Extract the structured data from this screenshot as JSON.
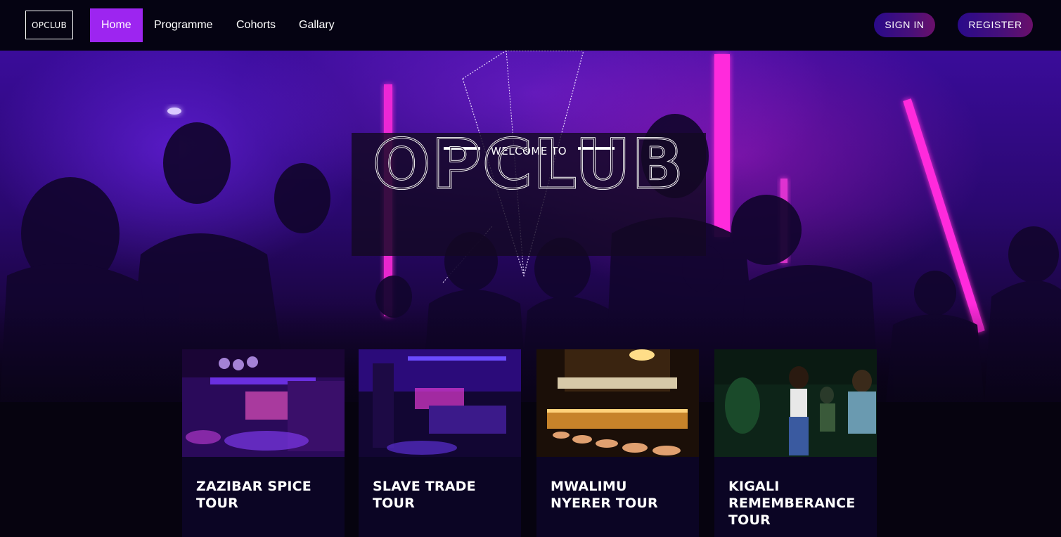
{
  "nav": {
    "logo": "OPCLUB",
    "links": [
      "Home",
      "Programme",
      "Cohorts",
      "Gallary"
    ],
    "active_link": "Home",
    "sign_in": "SIGN IN",
    "register": "REGISTER"
  },
  "hero": {
    "welcome": "WELCOME TO",
    "title": "OPCLUB"
  },
  "cards": [
    {
      "title": "ZAZIBAR SPICE TOUR"
    },
    {
      "title": "SLAVE TRADE TOUR"
    },
    {
      "title": "MWALIMU NYERER TOUR"
    },
    {
      "title": "KIGALI REMEMBERANCE TOUR"
    }
  ],
  "colors": {
    "accent": "#9d25f0",
    "nav_bg": "#050312",
    "card_bg": "#0b0524"
  }
}
